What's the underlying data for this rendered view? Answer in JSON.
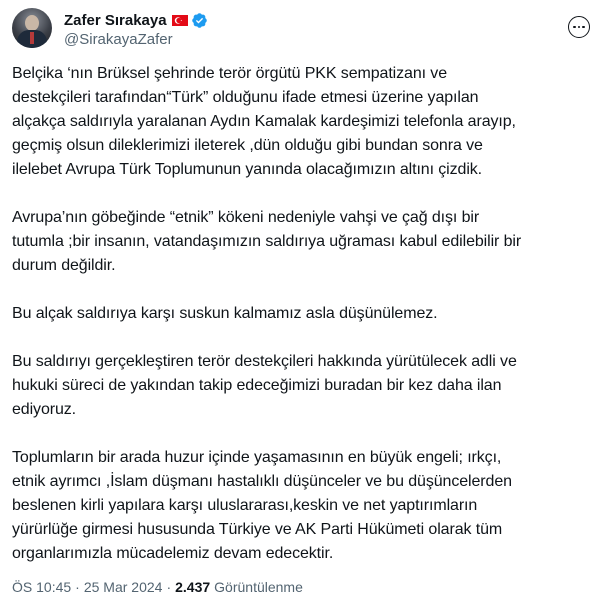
{
  "author": {
    "display_name": "Zafer Sırakaya",
    "handle": "@SirakayaZafer",
    "flag": "turkey-flag",
    "verified": true,
    "verified_color": "#1d9bf0"
  },
  "tweet": {
    "paragraphs": [
      [
        "Belçika ‘nın Brüksel şehrinde  terör örgütü PKK sempatizanı ve",
        "destekçileri tarafından“Türk” olduğunu ifade etmesi üzerine yapılan",
        "alçakça saldırıyla yaralanan Aydın Kamalak kardeşimizi telefonla arayıp,",
        "geçmiş olsun dileklerimizi ileterek ,dün olduğu gibi bundan sonra ve",
        "ilelebet Avrupa Türk Toplumunun yanında olacağımızın altını çizdik."
      ],
      [
        "Avrupa’nın göbeğinde “etnik” kökeni nedeniyle vahşi ve çağ dışı bir",
        "tutumla ;bir insanın, vatandaşımızın saldırıya uğraması kabul edilebilir bir",
        "durum değildir."
      ],
      [
        "Bu alçak saldırıya karşı suskun kalmamız  asla düşünülemez."
      ],
      [
        "Bu saldırıyı gerçekleştiren terör destekçileri hakkında yürütülecek adli ve",
        "hukuki süreci de yakından takip edeceğimizi buradan bir kez daha ilan",
        "ediyoruz."
      ],
      [
        "Toplumların bir arada huzur içinde yaşamasının en büyük engeli; ırkçı,",
        "etnik ayrımcı ,İslam düşmanı hastalıklı düşünceler ve bu düşüncelerden",
        "beslenen kirli yapılara karşı uluslararası,keskin ve net yaptırımların",
        "yürürlüğe girmesi  hususunda Türkiye ve AK Parti Hükümeti olarak tüm",
        "organlarımızla mücadelemiz devam edecektir."
      ]
    ]
  },
  "meta": {
    "time": "ÖS 10:45",
    "separator": "·",
    "date": "25 Mar 2024",
    "views_count": "2.437",
    "views_label": "Görüntülenme"
  },
  "icons": {
    "more": "more-options-icon",
    "verified": "verified-badge-icon"
  }
}
